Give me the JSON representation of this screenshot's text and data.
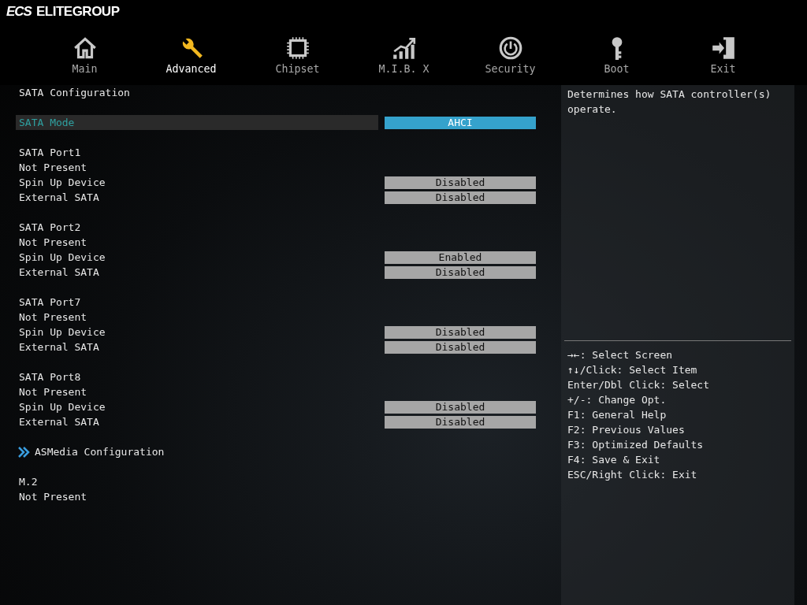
{
  "brand": {
    "mark": "ECS",
    "name": "ELITEGROUP"
  },
  "tabs": [
    {
      "label": "Main",
      "kind": "house",
      "selected": false
    },
    {
      "label": "Advanced",
      "kind": "wrench",
      "selected": true
    },
    {
      "label": "Chipset",
      "kind": "chip",
      "selected": false
    },
    {
      "label": "M.I.B. X",
      "kind": "chart",
      "selected": false
    },
    {
      "label": "Security",
      "kind": "power",
      "selected": false
    },
    {
      "label": "Boot",
      "kind": "key",
      "selected": false
    },
    {
      "label": "Exit",
      "kind": "door",
      "selected": false
    }
  ],
  "groups": [
    {
      "items": [
        {
          "kind": "label",
          "label": "SATA Configuration"
        }
      ]
    },
    {
      "items": [
        {
          "kind": "option",
          "label": "SATA Mode",
          "value": "AHCI",
          "selected": true
        }
      ]
    },
    {
      "items": [
        {
          "kind": "label",
          "label": "SATA Port1"
        },
        {
          "kind": "label",
          "label": "Not Present"
        },
        {
          "kind": "option",
          "label": "Spin Up Device",
          "value": "Disabled",
          "selected": false
        },
        {
          "kind": "option",
          "label": "External SATA",
          "value": "Disabled",
          "selected": false
        }
      ]
    },
    {
      "items": [
        {
          "kind": "label",
          "label": "SATA Port2"
        },
        {
          "kind": "label",
          "label": "Not Present"
        },
        {
          "kind": "option",
          "label": "Spin Up Device",
          "value": "Enabled",
          "selected": false
        },
        {
          "kind": "option",
          "label": "External SATA",
          "value": "Disabled",
          "selected": false
        }
      ]
    },
    {
      "items": [
        {
          "kind": "label",
          "label": "SATA Port7"
        },
        {
          "kind": "label",
          "label": "Not Present"
        },
        {
          "kind": "option",
          "label": "Spin Up Device",
          "value": "Disabled",
          "selected": false
        },
        {
          "kind": "option",
          "label": "External SATA",
          "value": "Disabled",
          "selected": false
        }
      ]
    },
    {
      "items": [
        {
          "kind": "label",
          "label": "SATA Port8"
        },
        {
          "kind": "label",
          "label": "Not Present"
        },
        {
          "kind": "option",
          "label": "Spin Up Device",
          "value": "Disabled",
          "selected": false
        },
        {
          "kind": "option",
          "label": "External SATA",
          "value": "Disabled",
          "selected": false
        }
      ]
    },
    {
      "items": [
        {
          "kind": "submenu",
          "label": "ASMedia Configuration"
        }
      ]
    },
    {
      "items": [
        {
          "kind": "label",
          "label": "M.2"
        },
        {
          "kind": "label",
          "label": "Not Present"
        }
      ]
    }
  ],
  "help": {
    "text": "Determines how SATA controller(s) operate.",
    "keys": [
      "→←: Select Screen",
      "↑↓/Click: Select Item",
      "Enter/Dbl Click: Select",
      "+/-: Change Opt.",
      "F1: General Help",
      "F2: Previous Values",
      "F3: Optimized Defaults",
      "F4: Save & Exit",
      "ESC/Right Click: Exit"
    ]
  }
}
